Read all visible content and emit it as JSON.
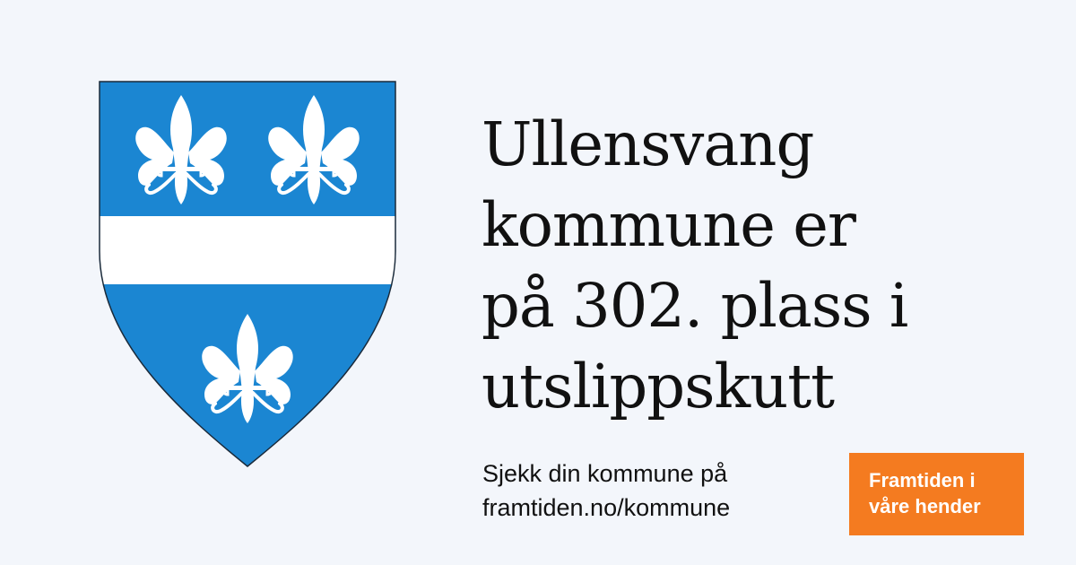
{
  "crest": {
    "charge": "fleur-de-lis",
    "colors": {
      "field": "#1b86d2",
      "charge": "#ffffff",
      "outline": "#1a2a3a"
    }
  },
  "headline": {
    "lines": [
      "Ullensvang",
      "kommune er",
      "på 302. plass i",
      "utslippskutt"
    ]
  },
  "cta": {
    "lines": [
      "Sjekk din kommune på",
      "framtiden.no/kommune"
    ]
  },
  "badge": {
    "lines": [
      "Framtiden i",
      "våre hender"
    ],
    "color": "#f47b20"
  },
  "background": "#f3f6fb"
}
